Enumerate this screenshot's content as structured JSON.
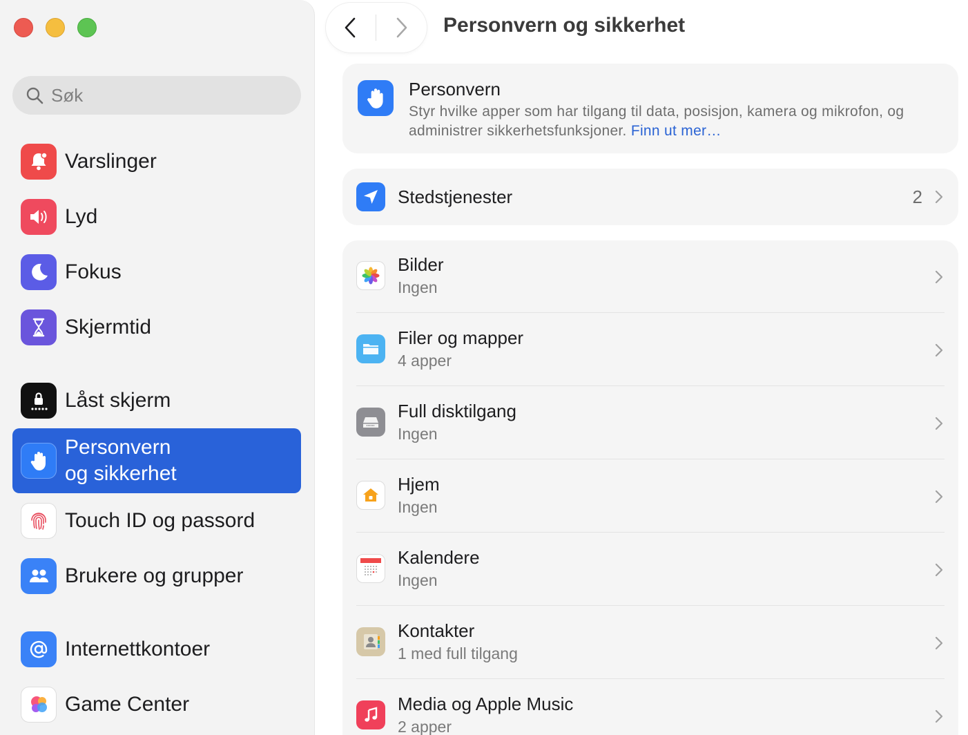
{
  "window": {
    "title": "Personvern og sikkerhet"
  },
  "search": {
    "placeholder": "Søk"
  },
  "sidebar": {
    "items": [
      {
        "label": "Varslinger",
        "icon": "bell-icon",
        "color": "#ef4a4a"
      },
      {
        "label": "Lyd",
        "icon": "speaker-icon",
        "color": "#ef4a5e"
      },
      {
        "label": "Fokus",
        "icon": "moon-icon",
        "color": "#5b5ce6"
      },
      {
        "label": "Skjermtid",
        "icon": "hourglass-icon",
        "color": "#6a55dc"
      },
      {
        "label": "Låst skjerm",
        "icon": "lock-screen-icon",
        "color": "#111111"
      },
      {
        "label": "Personvern\nog sikkerhet",
        "icon": "hand-icon",
        "color": "#2f7cf6",
        "selected": true
      },
      {
        "label": "Touch ID og passord",
        "icon": "fingerprint-icon",
        "color": "#ffffff"
      },
      {
        "label": "Brukere og grupper",
        "icon": "users-icon",
        "color": "#3a82f7"
      },
      {
        "label": "Internettkontoer",
        "icon": "at-icon",
        "color": "#3a82f7"
      },
      {
        "label": "Game Center",
        "icon": "game-center-icon",
        "color": "#ffffff"
      }
    ]
  },
  "header": {
    "title": "Personvern",
    "description": "Styr hvilke apper som har tilgang til data, posisjon, kamera og mikrofon, og administrer sikkerhetsfunksjoner.",
    "link": "Finn ut mer…"
  },
  "location": {
    "label": "Stedstjenester",
    "count": "2"
  },
  "privacy_items": [
    {
      "title": "Bilder",
      "subtitle": "Ingen",
      "icon": "photos-icon"
    },
    {
      "title": "Filer og mapper",
      "subtitle": "4 apper",
      "icon": "folder-icon"
    },
    {
      "title": "Full disktilgang",
      "subtitle": "Ingen",
      "icon": "disk-icon"
    },
    {
      "title": "Hjem",
      "subtitle": "Ingen",
      "icon": "home-icon"
    },
    {
      "title": "Kalendere",
      "subtitle": "Ingen",
      "icon": "calendar-icon"
    },
    {
      "title": "Kontakter",
      "subtitle": "1 med full tilgang",
      "icon": "contacts-icon"
    },
    {
      "title": "Media og Apple Music",
      "subtitle": "2 apper",
      "icon": "music-icon"
    }
  ],
  "colors": {
    "accent": "#2962d9",
    "link": "#2a63d4"
  }
}
